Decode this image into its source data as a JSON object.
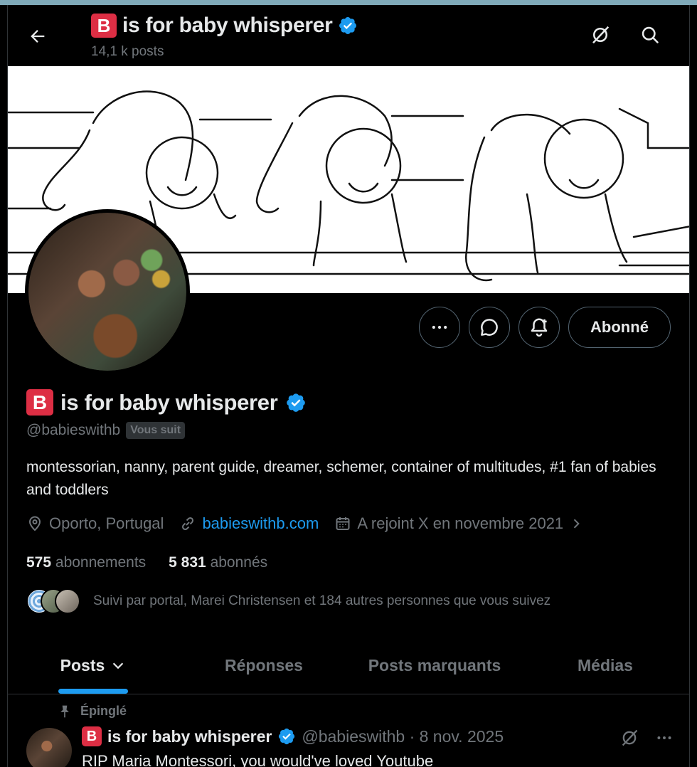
{
  "header": {
    "badge": "B",
    "title": "is for baby whisperer",
    "posts_count": "14,1 k posts",
    "icons": [
      "back-arrow-icon",
      "grok-icon",
      "search-icon",
      "verified-badge-icon"
    ]
  },
  "profile": {
    "badge": "B",
    "name": "is for baby whisperer",
    "handle": "@babieswithb",
    "follows_you": "Vous suit",
    "bio": "montessorian, nanny, parent guide, dreamer, schemer, container of multitudes, #1 fan of babies and toddlers",
    "location": "Oporto, Portugal",
    "website": "babieswithb.com",
    "joined": "A rejoint X en novembre 2021",
    "following_count": "575",
    "following_label": "abonnements",
    "followers_count": "5 831",
    "followers_label": "abonnés",
    "followed_by": "Suivi par portal, Marei Christensen et 184 autres personnes que vous suivez"
  },
  "actions": {
    "follow_label": "Abonné",
    "icons": [
      "more-icon",
      "message-icon",
      "notification-bell-icon"
    ]
  },
  "tabs": [
    {
      "label": "Posts",
      "active": true
    },
    {
      "label": "Réponses",
      "active": false
    },
    {
      "label": "Posts marquants",
      "active": false
    },
    {
      "label": "Médias",
      "active": false
    }
  ],
  "pinned_tweet": {
    "pinned_label": "Épinglé",
    "badge": "B",
    "name": "is for baby whisperer",
    "meta": "@babieswithb · 8 nov. 2025",
    "text": "RIP Maria Montessori, you would've loved Youtube"
  },
  "colors": {
    "background": "#000000",
    "accent": "#1d9bf0",
    "muted": "#71767b",
    "badge_red": "#dd2e44",
    "verified": "#1d9bf0"
  }
}
